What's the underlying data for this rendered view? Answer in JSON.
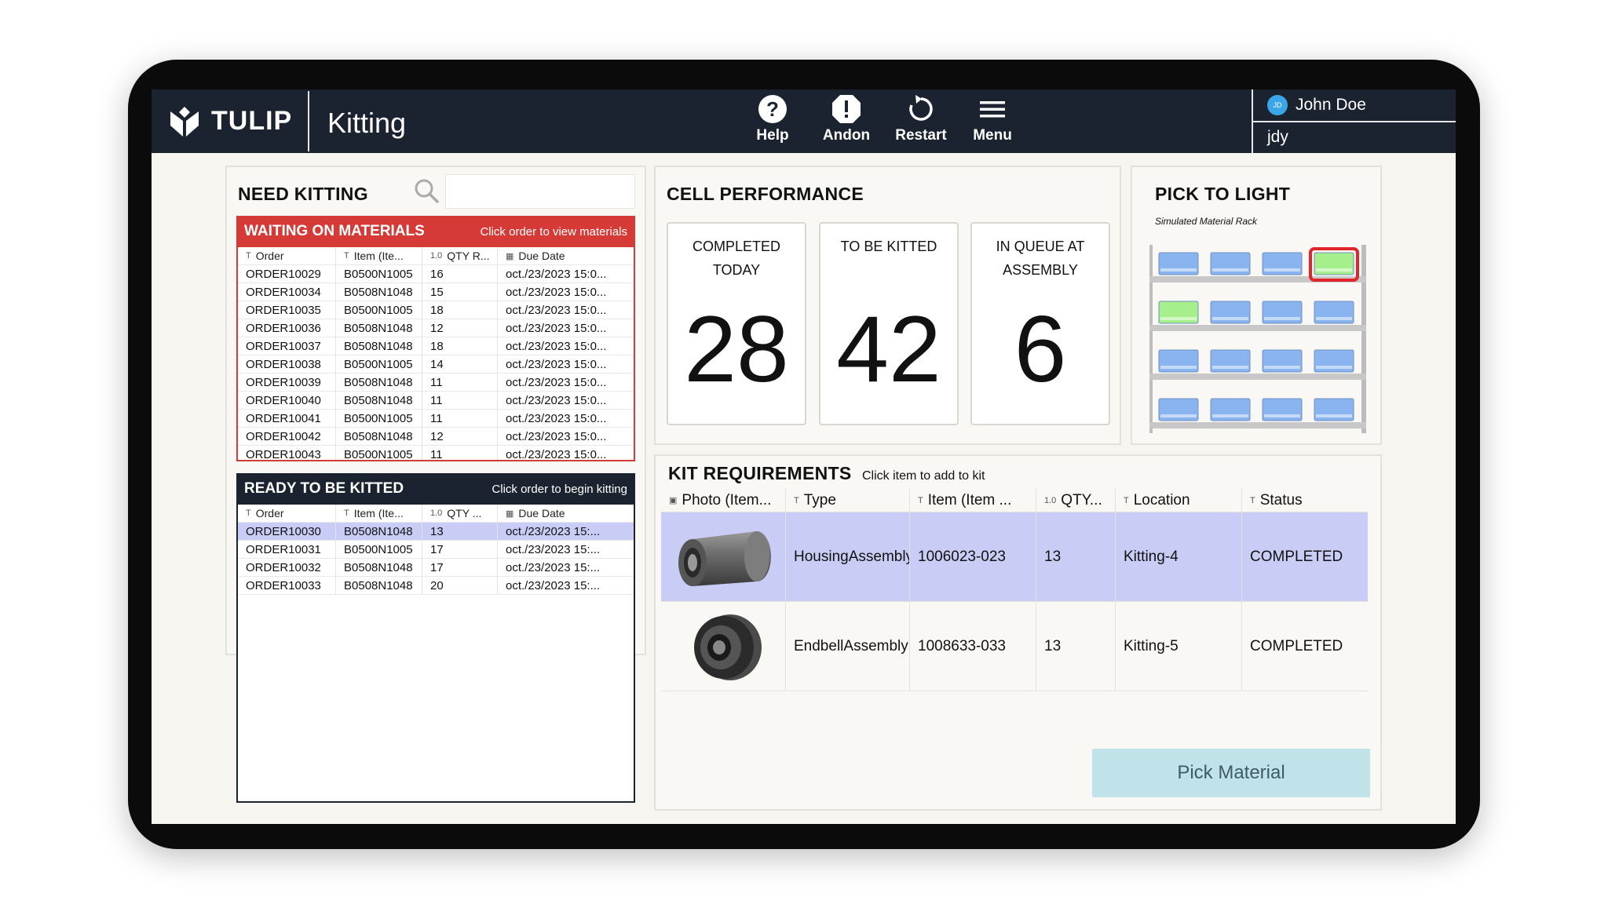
{
  "header": {
    "brand": "TULIP",
    "app_title": "Kitting",
    "buttons": [
      {
        "label": "Help",
        "icon": "help-icon"
      },
      {
        "label": "Andon",
        "icon": "alert-icon"
      },
      {
        "label": "Restart",
        "icon": "restart-icon"
      },
      {
        "label": "Menu",
        "icon": "menu-icon"
      }
    ],
    "user": {
      "initials": "JD",
      "name": "John Doe",
      "id": "jdy"
    }
  },
  "need_kitting": {
    "title": "NEED KITTING",
    "search_placeholder": "",
    "waiting": {
      "title": "WAITING ON MATERIALS",
      "hint": "Click order to view materials",
      "color": "#d63a36",
      "columns": [
        "Order",
        "Item (Ite...",
        "QTY R...",
        "Due Date"
      ],
      "rows": [
        [
          "ORDER10029",
          "B0500N1005",
          "16",
          "oct./23/2023 15:0..."
        ],
        [
          "ORDER10034",
          "B0508N1048",
          "15",
          "oct./23/2023 15:0..."
        ],
        [
          "ORDER10035",
          "B0500N1005",
          "18",
          "oct./23/2023 15:0..."
        ],
        [
          "ORDER10036",
          "B0508N1048",
          "12",
          "oct./23/2023 15:0..."
        ],
        [
          "ORDER10037",
          "B0508N1048",
          "18",
          "oct./23/2023 15:0..."
        ],
        [
          "ORDER10038",
          "B0500N1005",
          "14",
          "oct./23/2023 15:0..."
        ],
        [
          "ORDER10039",
          "B0508N1048",
          "11",
          "oct./23/2023 15:0..."
        ],
        [
          "ORDER10040",
          "B0508N1048",
          "11",
          "oct./23/2023 15:0..."
        ],
        [
          "ORDER10041",
          "B0500N1005",
          "11",
          "oct./23/2023 15:0..."
        ],
        [
          "ORDER10042",
          "B0508N1048",
          "12",
          "oct./23/2023 15:0..."
        ],
        [
          "ORDER10043",
          "B0500N1005",
          "11",
          "oct./23/2023 15:0..."
        ]
      ]
    },
    "ready": {
      "title": "READY TO BE KITTED",
      "hint": "Click order to begin kitting",
      "color": "#1b2330",
      "columns": [
        "Order",
        "Item (Ite...",
        "QTY ...",
        "Due Date"
      ],
      "rows": [
        [
          "ORDER10030",
          "B0508N1048",
          "13",
          "oct./23/2023 15:..."
        ],
        [
          "ORDER10031",
          "B0500N1005",
          "17",
          "oct./23/2023 15:..."
        ],
        [
          "ORDER10032",
          "B0508N1048",
          "17",
          "oct./23/2023 15:..."
        ],
        [
          "ORDER10033",
          "B0508N1048",
          "20",
          "oct./23/2023 15:..."
        ]
      ]
    }
  },
  "cell_performance": {
    "title": "CELL PERFORMANCE",
    "stats": [
      {
        "line1": "COMPLETED",
        "line2": "TODAY",
        "value": "28"
      },
      {
        "line1": "TO BE KITTED",
        "line2": "",
        "value": "42"
      },
      {
        "line1": "IN QUEUE AT",
        "line2": "ASSEMBLY",
        "value": "6"
      }
    ]
  },
  "pick_to_light": {
    "title": "PICK TO LIGHT",
    "caption": "Simulated Material Rack",
    "bin_color": "#8ab4ef",
    "lit_color": "#a7ee8c",
    "highlight_color": "#e0262b"
  },
  "kit_requirements": {
    "title": "KIT REQUIREMENTS",
    "hint": "Click item to add to kit",
    "columns": [
      "Photo (Item...",
      "Type",
      "Item (Item ...",
      "QTY...",
      "Location",
      "Status"
    ],
    "rows": [
      {
        "type_line1": "Housing",
        "type_line2": "Assembly",
        "item": "1006023-023",
        "qty": "13",
        "location": "Kitting-4",
        "status": "COMPLETED"
      },
      {
        "type_line1": "Endbell",
        "type_line2": "Assembly",
        "item": "1008633-033",
        "qty": "13",
        "location": "Kitting-5",
        "status": "COMPLETED"
      }
    ],
    "button_label": "Pick Material"
  }
}
